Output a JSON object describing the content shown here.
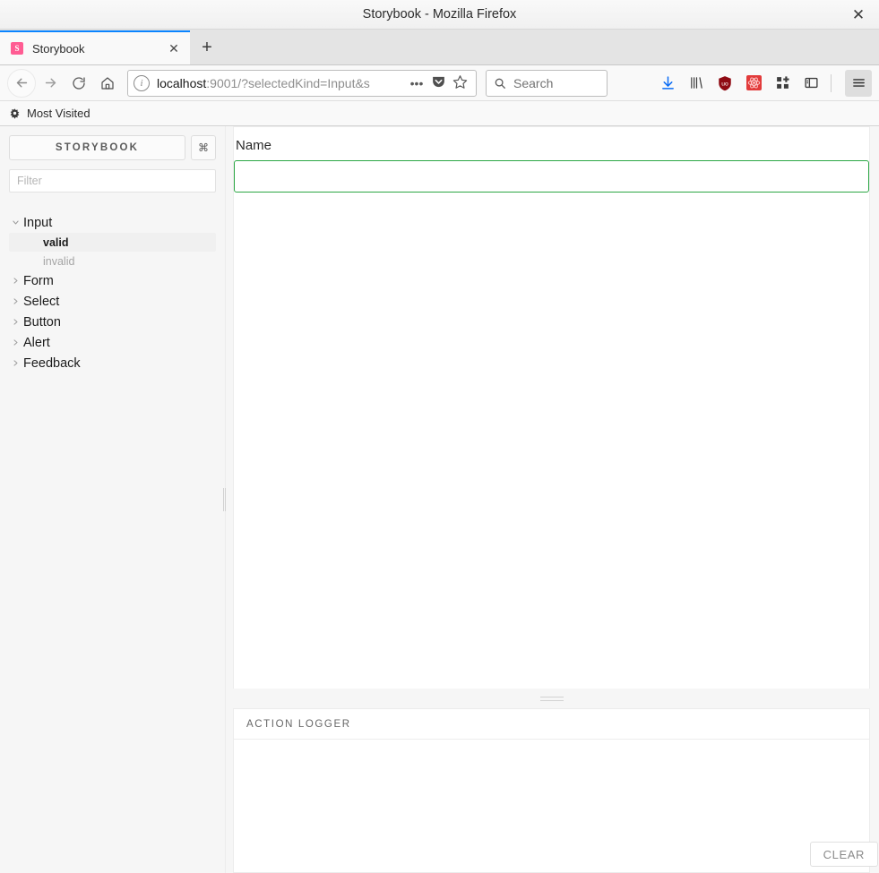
{
  "window": {
    "title": "Storybook - Mozilla Firefox",
    "close_label": "✕"
  },
  "tabs": [
    {
      "favicon_letter": "S",
      "title": "Storybook",
      "close_label": "✕"
    }
  ],
  "newtab_label": "+",
  "nav": {
    "back_icon": "arrow-left-icon",
    "forward_icon": "arrow-right-icon",
    "reload_icon": "reload-icon",
    "home_icon": "home-icon"
  },
  "urlbar": {
    "info_label": "i",
    "host": "localhost",
    "path": ":9001/?selectedKind=Input&s",
    "page_actions_label": "•••",
    "pocket_icon": "pocket-icon",
    "bookmark_icon": "star-icon"
  },
  "search": {
    "placeholder": "Search",
    "icon": "search-icon"
  },
  "toolbar_icons": [
    {
      "name": "downloads-icon"
    },
    {
      "name": "library-icon"
    },
    {
      "name": "ublock-origin-icon"
    },
    {
      "name": "react-devtools-icon"
    },
    {
      "name": "addons-grid-icon"
    },
    {
      "name": "sidebar-toggle-icon"
    },
    {
      "name": "hamburger-menu-icon"
    }
  ],
  "bookmarks": {
    "most_visited": "Most Visited"
  },
  "storybook": {
    "brand": "STORYBOOK",
    "shortcut_label": "⌘",
    "filter_placeholder": "Filter",
    "filter_value": "",
    "tree": [
      {
        "kind": "Input",
        "expanded": true,
        "stories": [
          {
            "label": "valid",
            "selected": true
          },
          {
            "label": "invalid",
            "selected": false
          }
        ]
      },
      {
        "kind": "Form",
        "expanded": false,
        "stories": []
      },
      {
        "kind": "Select",
        "expanded": false,
        "stories": []
      },
      {
        "kind": "Button",
        "expanded": false,
        "stories": []
      },
      {
        "kind": "Alert",
        "expanded": false,
        "stories": []
      },
      {
        "kind": "Feedback",
        "expanded": false,
        "stories": []
      }
    ]
  },
  "preview": {
    "field_label": "Name",
    "field_value": "",
    "field_placeholder": "",
    "valid_border_color": "#2ca745"
  },
  "addons": {
    "tabs": [
      {
        "label": "ACTION LOGGER",
        "active": true
      }
    ],
    "log_entries": [],
    "clear_label": "CLEAR"
  }
}
